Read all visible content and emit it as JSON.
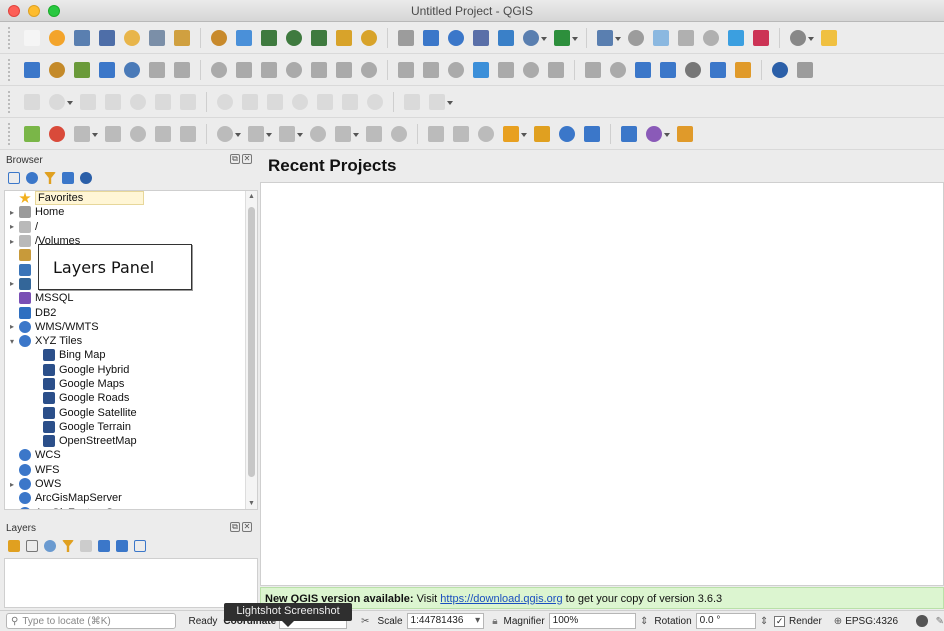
{
  "window": {
    "title": "Untitled Project - QGIS"
  },
  "browser_panel": {
    "title": "Browser",
    "items": [
      {
        "label": "Favorites",
        "arrow": "",
        "icon": "star-icon",
        "color": "#f2b01e"
      },
      {
        "label": "Home",
        "arrow": "▸",
        "icon": "home-folder-icon",
        "color": "#9a9a9a"
      },
      {
        "label": "/",
        "arrow": "▸",
        "icon": "folder-icon",
        "color": "#b9b9b9"
      },
      {
        "label": "/Volumes",
        "arrow": "▸",
        "icon": "folder-icon",
        "color": "#b9b9b9"
      },
      {
        "label": "",
        "arrow": "",
        "icon": "geopackage-icon",
        "color": "#c89a3a"
      },
      {
        "label": "",
        "arrow": "",
        "icon": "spatialite-icon",
        "color": "#3a74b8"
      },
      {
        "label": "",
        "arrow": "▸",
        "icon": "postgis-icon",
        "color": "#336699"
      },
      {
        "label": "MSSQL",
        "arrow": "",
        "icon": "mssql-icon",
        "color": "#7a4fb5"
      },
      {
        "label": "DB2",
        "arrow": "",
        "icon": "db2-icon",
        "color": "#2f6fc0"
      },
      {
        "label": "WMS/WMTS",
        "arrow": "▸",
        "icon": "globe-icon",
        "color": "#3b77c9"
      },
      {
        "label": "XYZ Tiles",
        "arrow": "▾",
        "icon": "globe-icon",
        "color": "#3b77c9"
      },
      {
        "label": "Bing Map",
        "arrow": "",
        "icon": "tiles-icon",
        "color": "#2b4f8a",
        "indent": true
      },
      {
        "label": "Google Hybrid",
        "arrow": "",
        "icon": "tiles-icon",
        "color": "#2b4f8a",
        "indent": true
      },
      {
        "label": "Google Maps",
        "arrow": "",
        "icon": "tiles-icon",
        "color": "#2b4f8a",
        "indent": true
      },
      {
        "label": "Google Roads",
        "arrow": "",
        "icon": "tiles-icon",
        "color": "#2b4f8a",
        "indent": true
      },
      {
        "label": "Google Satellite",
        "arrow": "",
        "icon": "tiles-icon",
        "color": "#2b4f8a",
        "indent": true
      },
      {
        "label": "Google Terrain",
        "arrow": "",
        "icon": "tiles-icon",
        "color": "#2b4f8a",
        "indent": true
      },
      {
        "label": "OpenStreetMap",
        "arrow": "",
        "icon": "tiles-icon",
        "color": "#2b4f8a",
        "indent": true
      },
      {
        "label": "WCS",
        "arrow": "",
        "icon": "wcs-icon",
        "color": "#3b77c9"
      },
      {
        "label": "WFS",
        "arrow": "",
        "icon": "wfs-icon",
        "color": "#3b77c9"
      },
      {
        "label": "OWS",
        "arrow": "▸",
        "icon": "ows-icon",
        "color": "#3b77c9"
      },
      {
        "label": "ArcGisMapServer",
        "arrow": "",
        "icon": "arcgis-icon",
        "color": "#3b77c9"
      },
      {
        "label": "ArcGisFeatureServer",
        "arrow": "",
        "icon": "arcgis-icon",
        "color": "#3b77c9"
      }
    ]
  },
  "callout": {
    "text": "Layers Panel"
  },
  "layers_panel": {
    "title": "Layers"
  },
  "main": {
    "title": "Recent Projects",
    "notice": {
      "prefix": "New QGIS version available:",
      "visit": " Visit ",
      "link": "https://download.qgis.org",
      "suffix": " to get your copy of version 3.6.3"
    }
  },
  "tooltip": {
    "text": "Lightshot Screenshot"
  },
  "statusbar": {
    "locate_placeholder": "Type to locate (⌘K)",
    "ready": "Ready",
    "coordinate_label": "Coordinate",
    "scale_label": "Scale",
    "scale_value": "1:44781436",
    "magnifier_label": "Magnifier",
    "magnifier_value": "100%",
    "rotation_label": "Rotation",
    "rotation_value": "0.0 °",
    "render_label": "Render",
    "crs": "EPSG:4326"
  },
  "toolbar_colors": {
    "row1": [
      "#f5f5f5",
      "#f3a42b",
      "#5a7fb0",
      "#4e6ea8",
      "#e8b54a",
      "#7b8fa8",
      "#d0a040",
      "#c88a2c",
      "#4a90d9",
      "#3f7a3f",
      "#3f7a3f",
      "#3f7a3f",
      "#d8a32a",
      "#d8a32a",
      "#9c9c9c",
      "#3b77c9",
      "#3b77c9",
      "#5a6fa8",
      "#3a80c8",
      "#5a7fb0",
      "#2d8f3c",
      "#5a7fb0",
      "#9c9c9c",
      "#8bb8e0",
      "#b0b0b0",
      "#b0b0b0",
      "#3b9fe0",
      "#cc3355",
      "#888",
      "#f0c040"
    ],
    "row2": [
      "#3b77c9",
      "#c48a2a",
      "#6a9a3a",
      "#3b77c9",
      "#4a7ab8",
      "#aaa",
      "#aaa",
      "#aaa",
      "#aaa",
      "#aaa",
      "#aaa",
      "#aaa",
      "#aaa",
      "#aaa",
      "#aaa",
      "#aaa",
      "#aaa",
      "#3b8fd9",
      "#aaa",
      "#aaa",
      "#aaa",
      "#aaa",
      "#aaa",
      "#3b77c9",
      "#3b77c9",
      "#777",
      "#3b77c9",
      "#e09a2a",
      "#2b5fa8",
      "#9c9c9c"
    ],
    "row3": [
      "#bbb",
      "#bbb",
      "#bbb",
      "#bbb",
      "#bbb",
      "#bbb",
      "#bbb",
      "#bbb",
      "#bbb",
      "#bbb",
      "#bbb",
      "#bbb",
      "#bbb",
      "#bbb",
      "#bbb",
      "#bbb"
    ],
    "row4": [
      "#7ab648",
      "#d94a3a",
      "#bbb",
      "#bbb",
      "#bbb",
      "#bbb",
      "#bbb",
      "#bbb",
      "#bbb",
      "#bbb",
      "#bbb",
      "#bbb",
      "#bbb",
      "#bbb",
      "#bbb",
      "#bbb",
      "#bbb",
      "#e8a020",
      "#e0a020",
      "#3b77c9",
      "#3b77c9",
      "#3b77c9",
      "#8a5ab8",
      "#e09a2a"
    ]
  }
}
